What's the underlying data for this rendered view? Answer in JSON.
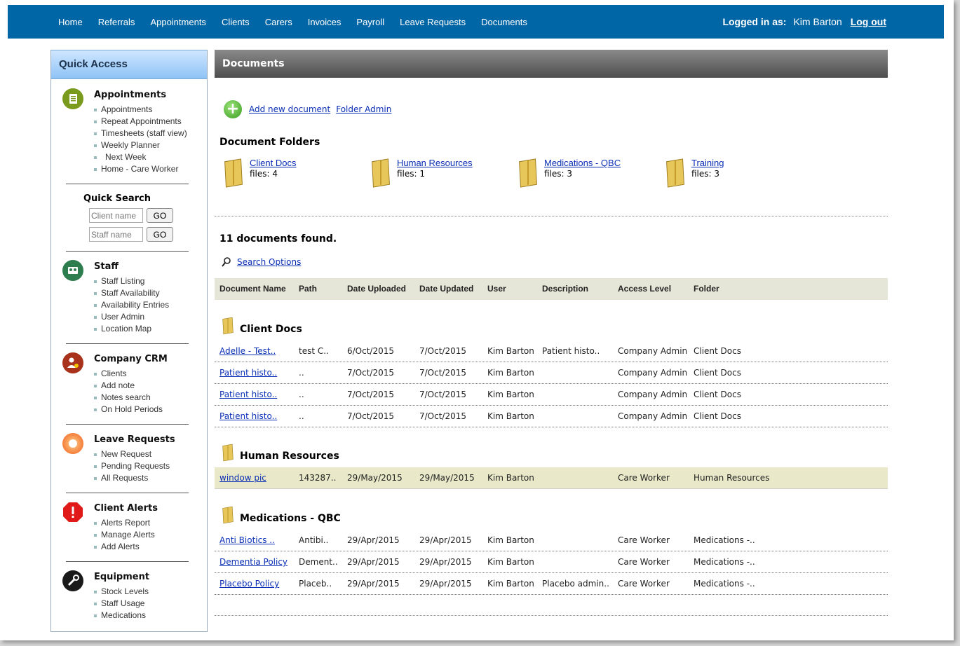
{
  "nav": {
    "items": [
      "Home",
      "Referrals",
      "Appointments",
      "Clients",
      "Carers",
      "Invoices",
      "Payroll",
      "Leave Requests",
      "Documents"
    ],
    "logged_in_label": "Logged in as:",
    "user_name": "Kim Barton",
    "logout": "Log out"
  },
  "sidebar": {
    "title": "Quick Access",
    "appointments": {
      "title": "Appointments",
      "items": [
        "Appointments",
        "Repeat Appointments",
        "Timesheets (staff view)",
        "Weekly Planner",
        "Next Week",
        "Home - Care Worker"
      ]
    },
    "quick_search": {
      "title": "Quick Search",
      "client_placeholder": "Client name",
      "staff_placeholder": "Staff name",
      "go": "GO"
    },
    "staff": {
      "title": "Staff",
      "items": [
        "Staff Listing",
        "Staff Availability",
        "Availability Entries",
        "User Admin",
        "Location Map"
      ]
    },
    "crm": {
      "title": "Company CRM",
      "items": [
        "Clients",
        "Add note",
        "Notes search",
        "On Hold Periods"
      ]
    },
    "leave": {
      "title": "Leave Requests",
      "items": [
        "New Request",
        "Pending Requests",
        "All Requests"
      ]
    },
    "alerts": {
      "title": "Client Alerts",
      "items": [
        "Alerts Report",
        "Manage Alerts",
        "Add Alerts"
      ]
    },
    "equipment": {
      "title": "Equipment",
      "items": [
        "Stock Levels",
        "Staff Usage",
        "Medications"
      ]
    }
  },
  "main": {
    "panel_title": "Documents",
    "add_new": "Add new document",
    "folder_admin": "Folder Admin",
    "folders_title": "Document Folders",
    "folders": [
      {
        "name": "Client Docs",
        "files": "files: 4"
      },
      {
        "name": "Human Resources",
        "files": "files: 1"
      },
      {
        "name": "Medications - QBC",
        "files": "files: 3"
      },
      {
        "name": "Training",
        "files": "files: 3"
      }
    ],
    "found": "11 documents found.",
    "search_options": "Search Options",
    "columns": [
      "Document Name",
      "Path",
      "Date Uploaded",
      "Date Updated",
      "User",
      "Description",
      "Access Level",
      "Folder"
    ],
    "groups": [
      {
        "title": "Client Docs",
        "rows": [
          [
            "Adelle - Test..",
            "test C..",
            "6/Oct/2015",
            "7/Oct/2015",
            "Kim Barton",
            "Patient histo..",
            "Company Admin",
            "Client Docs"
          ],
          [
            "Patient histo..",
            "..",
            "7/Oct/2015",
            "7/Oct/2015",
            "Kim Barton",
            "",
            "Company Admin",
            "Client Docs"
          ],
          [
            "Patient histo..",
            "..",
            "7/Oct/2015",
            "7/Oct/2015",
            "Kim Barton",
            "",
            "Company Admin",
            "Client Docs"
          ],
          [
            "Patient histo..",
            "..",
            "7/Oct/2015",
            "7/Oct/2015",
            "Kim Barton",
            "",
            "Company Admin",
            "Client Docs"
          ]
        ]
      },
      {
        "title": "Human Resources",
        "rows": [
          [
            "window pic",
            "143287..",
            "29/May/2015",
            "29/May/2015",
            "Kim Barton",
            "",
            "Care Worker",
            "Human Resources"
          ]
        ]
      },
      {
        "title": "Medications - QBC",
        "rows": [
          [
            "Anti Biotics ..",
            "Antibi..",
            "29/Apr/2015",
            "29/Apr/2015",
            "Kim Barton",
            "",
            "Care Worker",
            "Medications -.."
          ],
          [
            "Dementia Policy",
            "Dement..",
            "29/Apr/2015",
            "29/Apr/2015",
            "Kim Barton",
            "",
            "Care Worker",
            "Medications -.."
          ],
          [
            "Placebo Policy",
            "Placeb..",
            "29/Apr/2015",
            "29/Apr/2015",
            "Kim Barton",
            "Placebo admin..",
            "Care Worker",
            "Medications -.."
          ]
        ]
      }
    ]
  }
}
